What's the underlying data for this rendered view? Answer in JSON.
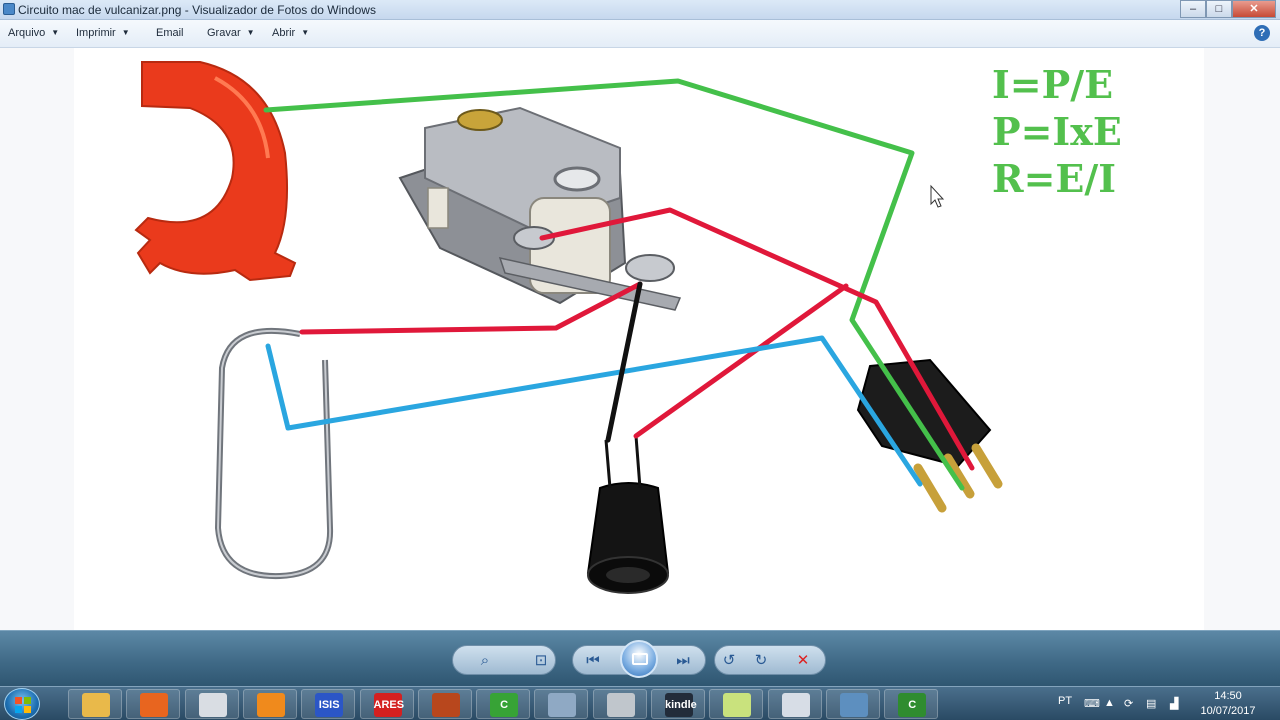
{
  "window": {
    "title": "Circuito mac de vulcanizar.png - Visualizador de Fotos do Windows",
    "minimize_label": "–",
    "maximize_label": "□",
    "close_label": "✕"
  },
  "menu": {
    "items": [
      {
        "label": "Arquivo",
        "has_dropdown": true
      },
      {
        "label": "Imprimir",
        "has_dropdown": true
      },
      {
        "label": "Email",
        "has_dropdown": false
      },
      {
        "label": "Gravar",
        "has_dropdown": true
      },
      {
        "label": "Abrir",
        "has_dropdown": true
      }
    ],
    "help_label": "?"
  },
  "image": {
    "formulas": [
      "I=P/E",
      "P=IxE",
      "R=E/I"
    ],
    "formula_color": "#53c04d",
    "wire_colors": {
      "green": "#44c04a",
      "red": "#e0183a",
      "blue": "#2aa6e0",
      "black": "#111111"
    },
    "components": [
      "plastic-clamp",
      "thermostat",
      "heating-element",
      "lamp-socket",
      "power-plug"
    ]
  },
  "viewer_controls": [
    {
      "name": "zoom",
      "icon": "magnifier-icon"
    },
    {
      "name": "actual-size",
      "icon": "fit-icon"
    },
    {
      "name": "previous",
      "icon": "previous-icon"
    },
    {
      "name": "slideshow",
      "icon": "slideshow-icon"
    },
    {
      "name": "next",
      "icon": "next-icon"
    },
    {
      "name": "rotate-left",
      "icon": "rotate-left-icon"
    },
    {
      "name": "rotate-right",
      "icon": "rotate-right-icon"
    },
    {
      "name": "delete",
      "icon": "delete-icon"
    }
  ],
  "taskbar": {
    "apps": [
      {
        "name": "explorer",
        "label": "",
        "color": "#e9b94a"
      },
      {
        "name": "firefox",
        "label": "",
        "color": "#e8651f"
      },
      {
        "name": "notepad",
        "label": "",
        "color": "#d9dde3"
      },
      {
        "name": "media-player",
        "label": "",
        "color": "#f08a1c"
      },
      {
        "name": "isis",
        "label": "ISIS",
        "color": "#2b56c6"
      },
      {
        "name": "ares",
        "label": "ARES",
        "color": "#d42020"
      },
      {
        "name": "app-red",
        "label": "",
        "color": "#b8471d"
      },
      {
        "name": "camtasia",
        "label": "C",
        "color": "#37a336"
      },
      {
        "name": "calculator",
        "label": "",
        "color": "#8fa9c4"
      },
      {
        "name": "tool",
        "label": "",
        "color": "#c0c6cc"
      },
      {
        "name": "kindle",
        "label": "kindle",
        "color": "#222c3a"
      },
      {
        "name": "folder",
        "label": "",
        "color": "#c9e27d"
      },
      {
        "name": "paint",
        "label": "",
        "color": "#d7dde6"
      },
      {
        "name": "photo-viewer",
        "label": "",
        "color": "#5d8fbf"
      },
      {
        "name": "camtasia-2",
        "label": "C",
        "color": "#2f8c2f"
      }
    ],
    "tray": {
      "language": "PT",
      "time": "14:50",
      "date": "10/07/2017"
    }
  }
}
